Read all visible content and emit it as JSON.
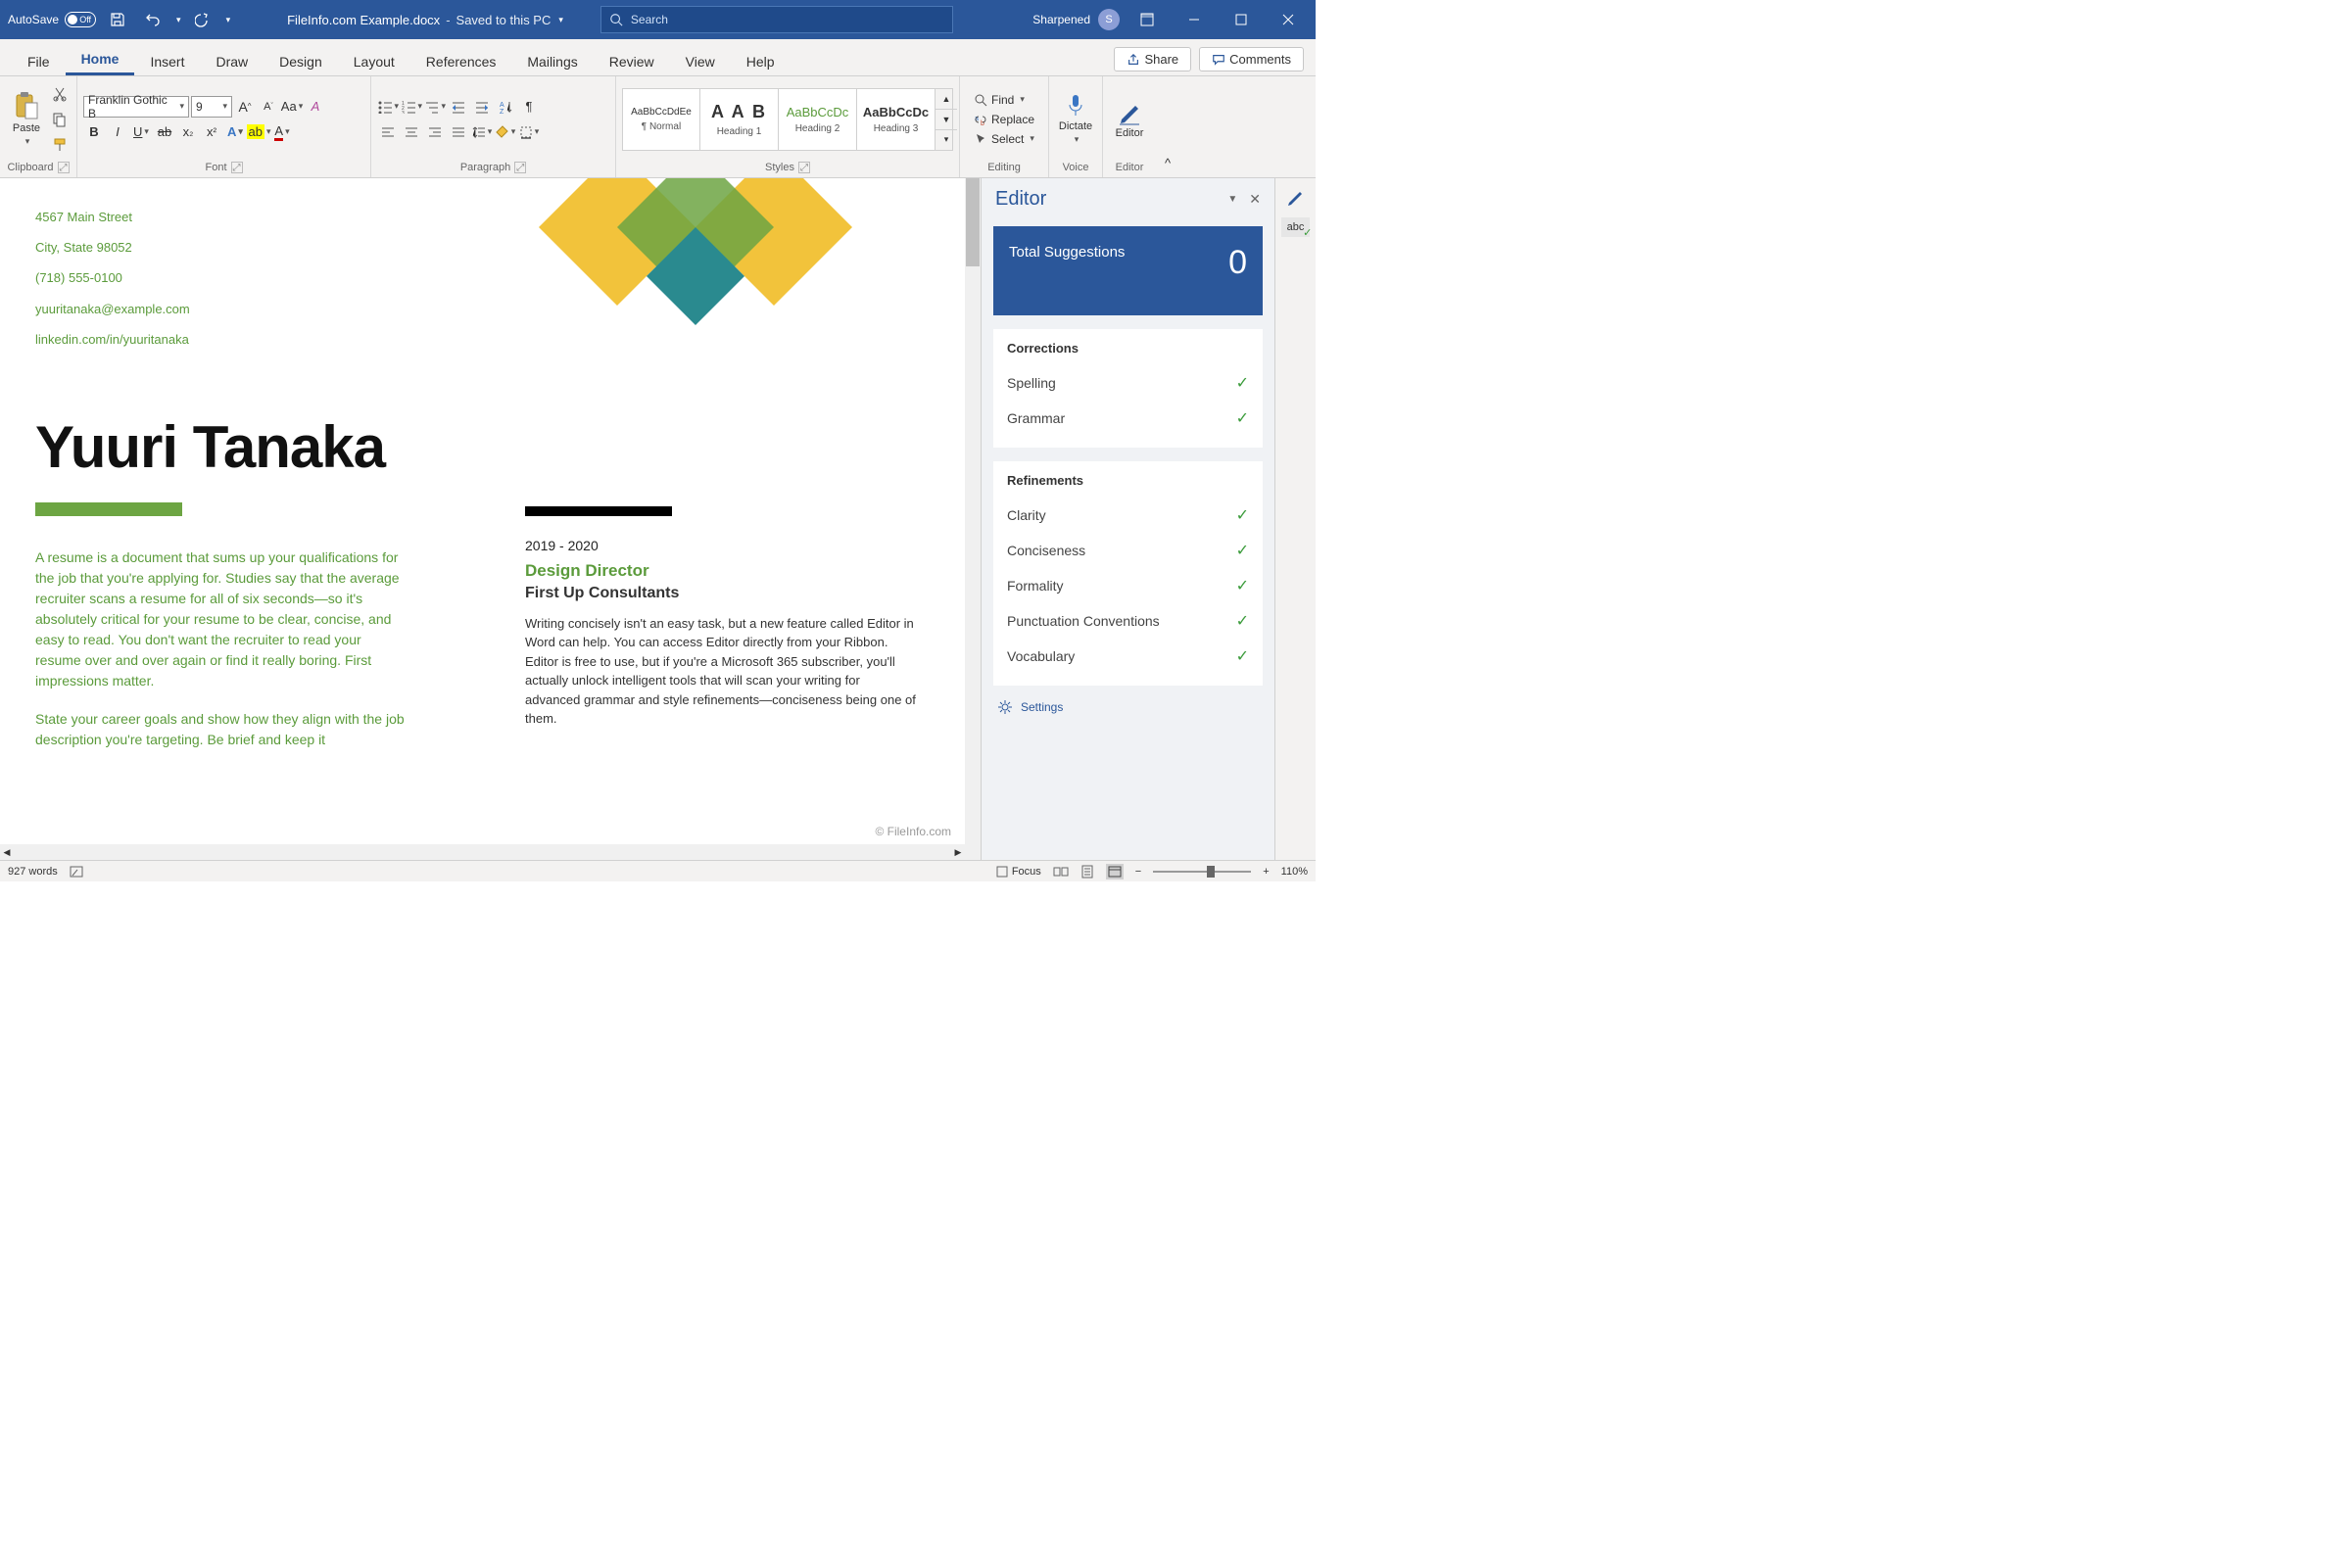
{
  "titlebar": {
    "autosave_label": "AutoSave",
    "autosave_state": "Off",
    "filename": "FileInfo.com Example.docx",
    "saved_status": "Saved to this PC",
    "search_placeholder": "Search",
    "user_name": "Sharpened",
    "user_initial": "S"
  },
  "tabs": {
    "items": [
      "File",
      "Home",
      "Insert",
      "Draw",
      "Design",
      "Layout",
      "References",
      "Mailings",
      "Review",
      "View",
      "Help"
    ],
    "active": "Home",
    "share": "Share",
    "comments": "Comments"
  },
  "ribbon": {
    "clipboard": {
      "label": "Clipboard",
      "paste": "Paste"
    },
    "font": {
      "label": "Font",
      "name": "Franklin Gothic B",
      "size": "9"
    },
    "paragraph": {
      "label": "Paragraph"
    },
    "styles": {
      "label": "Styles",
      "items": [
        {
          "preview": "AaBbCcDdEe",
          "name": "¶ Normal",
          "size": "10px"
        },
        {
          "preview": "A A B",
          "name": "Heading 1",
          "size": "18px"
        },
        {
          "preview": "AaBbCcDc",
          "name": "Heading 2",
          "size": "13px"
        },
        {
          "preview": "AaBbCcDc",
          "name": "Heading 3",
          "size": "13px"
        }
      ]
    },
    "editing": {
      "label": "Editing",
      "find": "Find",
      "replace": "Replace",
      "select": "Select"
    },
    "voice": {
      "label": "Voice",
      "dictate": "Dictate"
    },
    "editor": {
      "label": "Editor",
      "button": "Editor"
    }
  },
  "document": {
    "contact": {
      "address": "4567 Main Street",
      "city": "City, State 98052",
      "phone": "(718) 555-0100",
      "email": "yuuritanaka@example.com",
      "linkedin": "linkedin.com/in/yuuritanaka"
    },
    "name": "Yuuri Tanaka",
    "summary1": "A resume is a document that sums up your qualifications for the job that you're applying for. Studies say that the average recruiter scans a resume for all of six seconds—so it's absolutely critical for your resume to be clear, concise, and easy to read. You don't want the recruiter to read your resume over and over again or find it really boring. First impressions matter.",
    "summary2": "State your career goals and show how they align with the job description you're targeting. Be brief and keep it",
    "experience": {
      "dates": "2019 - 2020",
      "title": "Design Director",
      "company": "First Up Consultants",
      "desc": "Writing concisely isn't an easy task, but a new feature called Editor in Word can help. You can access Editor directly from your Ribbon. Editor is free to use, but if you're a Microsoft 365 subscriber, you'll actually unlock intelligent tools that will scan your writing for advanced grammar and style refinements—conciseness being one of them."
    }
  },
  "editor_pane": {
    "title": "Editor",
    "suggestions_label": "Total Suggestions",
    "suggestions_count": "0",
    "corrections": {
      "heading": "Corrections",
      "items": [
        "Spelling",
        "Grammar"
      ]
    },
    "refinements": {
      "heading": "Refinements",
      "items": [
        "Clarity",
        "Conciseness",
        "Formality",
        "Punctuation Conventions",
        "Vocabulary"
      ]
    },
    "settings": "Settings"
  },
  "statusbar": {
    "words": "927 words",
    "focus": "Focus",
    "zoom": "110%"
  },
  "watermark": "© FileInfo.com"
}
